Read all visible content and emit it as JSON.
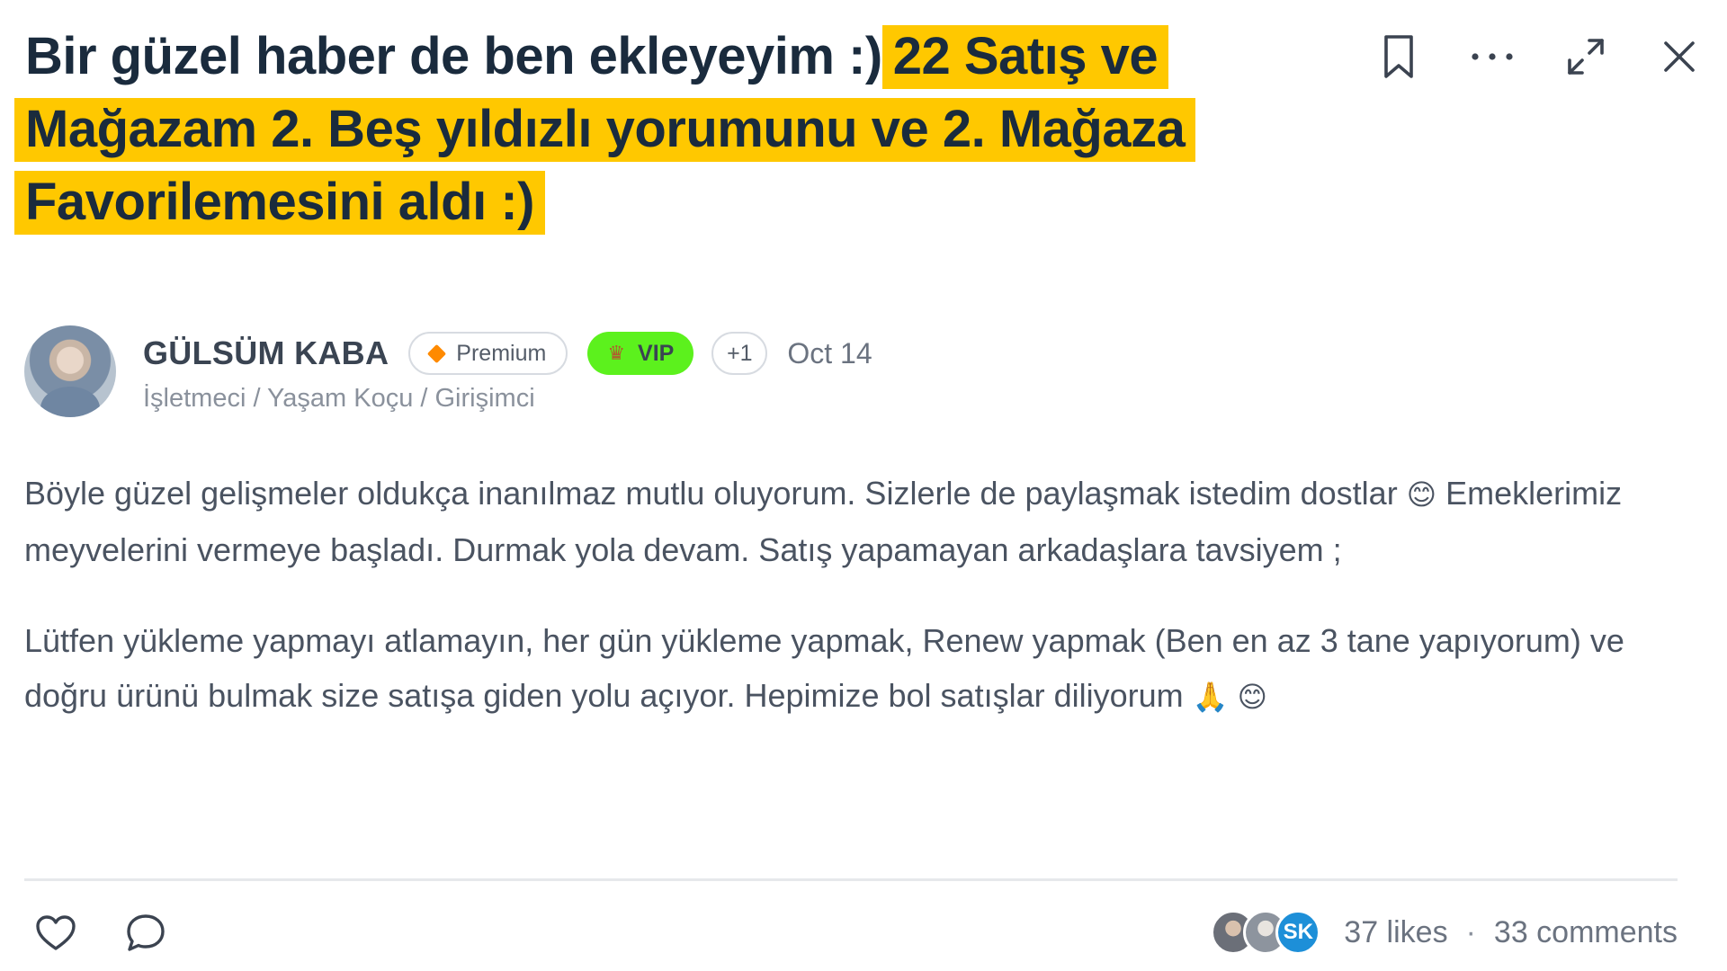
{
  "post": {
    "title_plain": "Bir güzel haber de ben ekleyeyim :)",
    "title_highlight": "22 Satış ve Mağazam 2. Beş yıldızlı yorumunu ve 2. Mağaza Favorilemesini aldı :)",
    "highlight_color": "#ffc800"
  },
  "actions": {
    "bookmark_icon": "bookmark-icon",
    "more_icon": "more-horizontal-icon",
    "expand_icon": "expand-icon",
    "close_icon": "close-icon"
  },
  "author": {
    "name": "GÜLSÜM KABA",
    "role": "İşletmeci / Yaşam Koçu / Girişimci",
    "badges": {
      "premium": "Premium",
      "vip": "VIP",
      "more": "+1"
    },
    "date": "Oct 14",
    "vip_color": "#5cf11d",
    "premium_icon_color": "#ff8a00"
  },
  "body": {
    "p1_a": "Böyle güzel gelişmeler oldukça inanılmaz mutlu oluyorum. Sizlerle de paylaşmak istedim dostlar",
    "p1_emoji": "😊",
    "p1_b": "Emeklerimiz meyvelerini vermeye başladı. Durmak yola devam. Satış yapamayan arkadaşlara tavsiyem ;",
    "p2": "Lütfen yükleme yapmayı atlamayın, her gün yükleme yapmak, Renew yapmak (Ben en az 3 tane yapıyorum) ve doğru ürünü bulmak size satışa giden yolu açıyor. Hepimize bol satışlar diliyorum",
    "p2_emojis": "🙏 😊"
  },
  "footer": {
    "like_icon": "heart-icon",
    "comment_icon": "comment-icon",
    "liker_initials": "SK",
    "likes": "37 likes",
    "separator": "·",
    "comments": "33 comments",
    "liker_badge_color": "#1d8fd8"
  }
}
